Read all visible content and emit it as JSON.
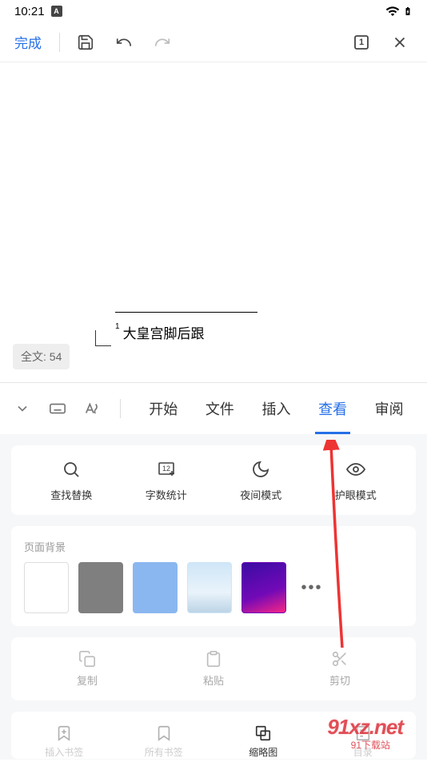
{
  "status": {
    "time": "10:21",
    "a": "A"
  },
  "toolbar": {
    "done": "完成",
    "page_badge": "1"
  },
  "canvas": {
    "note_marker": "1",
    "text": "大皇宫脚后跟",
    "word_count": "全文: 54"
  },
  "tabs": {
    "items": [
      "开始",
      "文件",
      "插入",
      "查看",
      "审阅"
    ],
    "activeIndex": 3
  },
  "tools": {
    "items": [
      {
        "label": "查找替换",
        "icon": "search"
      },
      {
        "label": "字数统计",
        "icon": "wordcount"
      },
      {
        "label": "夜间模式",
        "icon": "night"
      },
      {
        "label": "护眼模式",
        "icon": "eye"
      }
    ]
  },
  "background": {
    "title": "页面背景",
    "colors": [
      "#ffffff",
      "#7f7f7f",
      "#8bb7f0",
      "linear-gradient(180deg,#cfe6f7,#e9f3fb 60%,#bcd4e5)",
      "linear-gradient(160deg,#3a0ca3,#7209b7 60%,#f72585)"
    ],
    "more": "•••"
  },
  "edit": {
    "items": [
      {
        "label": "复制"
      },
      {
        "label": "粘贴"
      },
      {
        "label": "剪切"
      }
    ]
  },
  "bottom": {
    "items": [
      {
        "label": "插入书签",
        "icon": "bookmark-add"
      },
      {
        "label": "所有书签",
        "icon": "bookmark"
      },
      {
        "label": "缩略图",
        "icon": "thumbnail",
        "active": true
      },
      {
        "label": "目录",
        "icon": "toc"
      }
    ]
  },
  "watermark": {
    "main": "91xz.net",
    "sub": "91下载站"
  }
}
